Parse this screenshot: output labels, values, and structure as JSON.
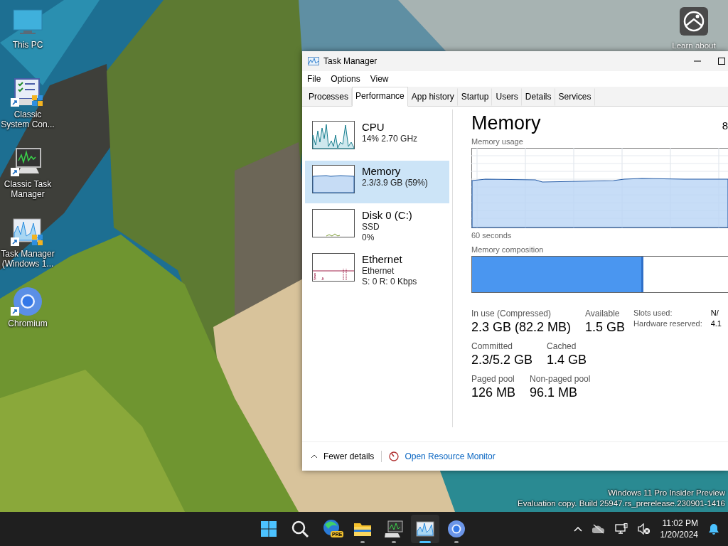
{
  "desktop_icons": [
    {
      "label": "This PC",
      "kind": "monitor",
      "shortcut": false
    },
    {
      "label": "Classic System Con...",
      "kind": "control",
      "shortcut": true
    },
    {
      "label": "Classic Task Manager",
      "kind": "classic-tm",
      "shortcut": true
    },
    {
      "label": "Task Manager (Windows 1...",
      "kind": "taskmgr",
      "shortcut": true
    },
    {
      "label": "Chromium",
      "kind": "browser",
      "shortcut": true
    }
  ],
  "learn_about": {
    "label": "Learn about"
  },
  "os_watermark": [
    "Windows 11 Pro Insider Preview",
    "Evaluation copy. Build 25947.rs_prerelease.230901-1416"
  ],
  "task_manager": {
    "title": "Task Manager",
    "menu": [
      "File",
      "Options",
      "View"
    ],
    "tabs": [
      {
        "label": "Processes",
        "selected": false
      },
      {
        "label": "Performance",
        "selected": true
      },
      {
        "label": "App history",
        "selected": false
      },
      {
        "label": "Startup",
        "selected": false
      },
      {
        "label": "Users",
        "selected": false
      },
      {
        "label": "Details",
        "selected": false
      },
      {
        "label": "Services",
        "selected": false
      }
    ],
    "resources": [
      {
        "name": "CPU",
        "kind": "cpu",
        "lines": [
          "14% 2.70 GHz"
        ],
        "selected": false
      },
      {
        "name": "Memory",
        "kind": "memory",
        "lines": [
          "2.3/3.9 GB (59%)"
        ],
        "selected": true
      },
      {
        "name": "Disk 0 (C:)",
        "kind": "disk",
        "lines": [
          "SSD",
          "0%"
        ],
        "selected": false
      },
      {
        "name": "Ethernet",
        "kind": "network",
        "lines": [
          "Ethernet",
          "S: 0 R: 0 Kbps"
        ],
        "selected": false
      }
    ],
    "detail": {
      "title": "Memory",
      "total": "8",
      "usage_label": "Memory usage",
      "time_label": "60 seconds",
      "composition_label": "Memory composition",
      "composition": {
        "level": 0.67
      },
      "stat_rows": [
        [
          {
            "label": "In use (Compressed)",
            "value": "2.3 GB (82.2 MB)"
          },
          {
            "label": "Available",
            "value": "1.5 GB"
          }
        ],
        [
          {
            "label": "Committed",
            "value": "2.3/5.2 GB"
          },
          {
            "label": "Cached",
            "value": "1.4 GB"
          }
        ],
        [
          {
            "label": "Paged pool",
            "value": "126 MB"
          },
          {
            "label": "Non-paged pool",
            "value": "96.1 MB"
          }
        ]
      ],
      "side_stats": [
        {
          "label": "Slots used:",
          "value": "N/"
        },
        {
          "label": "Hardware reserved:",
          "value": "4.1"
        }
      ]
    },
    "footer": {
      "fewer_details": "Fewer details",
      "resource_monitor": "Open Resource Monitor"
    }
  },
  "taskbar": {
    "apps": [
      {
        "kind": "start",
        "running": false,
        "selected": false
      },
      {
        "kind": "search",
        "running": false,
        "selected": false
      },
      {
        "kind": "edge",
        "badge": "PRE",
        "running": false,
        "selected": false
      },
      {
        "kind": "files",
        "running": true,
        "selected": false
      },
      {
        "kind": "classic-tm",
        "running": true,
        "selected": false
      },
      {
        "kind": "taskmgr",
        "running": true,
        "selected": true
      },
      {
        "kind": "browser",
        "running": true,
        "selected": false
      }
    ],
    "time": "11:02 PM",
    "date": "1/20/2024"
  }
}
